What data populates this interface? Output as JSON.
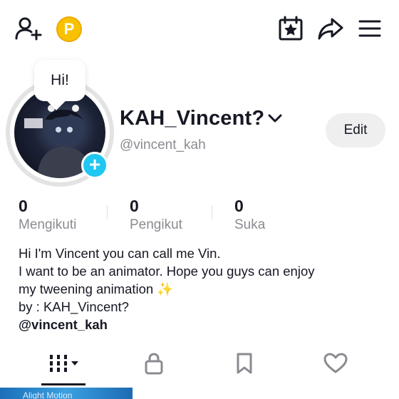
{
  "topbar": {
    "add_friend_icon": "person-plus-icon",
    "coin_letter": "P",
    "calendar_icon": "calendar-star-icon",
    "share_icon": "share-arrow-icon",
    "menu_icon": "hamburger-menu-icon"
  },
  "profile": {
    "bubble_text": "Hi!",
    "username": "KAH_Vincent?",
    "handle": "@vincent_kah",
    "edit_label": "Edit",
    "add_avatar_symbol": "+"
  },
  "stats": [
    {
      "value": "0",
      "label": "Mengikuti"
    },
    {
      "value": "0",
      "label": "Pengikut"
    },
    {
      "value": "0",
      "label": "Suka"
    }
  ],
  "bio": {
    "line1": "Hi I'm Vincent you can call me Vin.",
    "line2": "I want to be an animator. Hope you guys can enjoy",
    "line3": "my tweening animation ✨",
    "line4": "by : KAH_Vincent?",
    "handle": "@vincent_kah"
  },
  "tabs": {
    "videos_icon": "grid-videos-icon",
    "private_icon": "lock-icon",
    "saved_icon": "bookmark-icon",
    "liked_icon": "heart-icon"
  },
  "thumbnail": {
    "text": "Alight Motion"
  },
  "colors": {
    "accent_blue": "#20c7f0",
    "coin_gold": "#f8c200",
    "muted_text": "#8a8b91"
  }
}
